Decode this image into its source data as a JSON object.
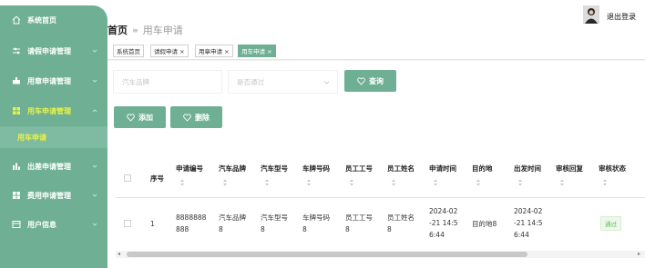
{
  "sidebar": {
    "items": [
      {
        "label": "系统首页",
        "icon": "home-icon"
      },
      {
        "label": "请假申请管理",
        "icon": "sliders-icon"
      },
      {
        "label": "用章申请管理",
        "icon": "stamp-icon"
      },
      {
        "label": "用车申请管理",
        "icon": "grid-icon"
      },
      {
        "label": "出差申请管理",
        "icon": "bar-chart-icon"
      },
      {
        "label": "费用申请管理",
        "icon": "grid-icon"
      },
      {
        "label": "用户信息",
        "icon": "card-icon"
      }
    ],
    "active_sub": "用车申请"
  },
  "header": {
    "breadcrumb_home": "首页",
    "breadcrumb_current": "用车申请",
    "logout_label": "退出登录"
  },
  "tags": [
    {
      "label": "系统首页"
    },
    {
      "label": "请假申请 ×"
    },
    {
      "label": "用章申请 ×"
    },
    {
      "label": "用车申请 ×"
    }
  ],
  "search": {
    "brand_placeholder": "汽车品牌",
    "approval_placeholder": "是否通过",
    "query_label": "查询"
  },
  "actions": {
    "add_label": "添加",
    "delete_label": "删除"
  },
  "table": {
    "columns": [
      "序号",
      "申请编号",
      "汽车品牌",
      "汽车型号",
      "车牌号码",
      "员工工号",
      "员工姓名",
      "申请时间",
      "目的地",
      "出发时间",
      "审核回复",
      "审核状态"
    ],
    "rows": [
      {
        "index": "1",
        "apply_no": "8888888\n888",
        "brand": "汽车品牌\n8",
        "model": "汽车型号\n8",
        "plate": "车牌号码\n8",
        "emp_no": "员工工号\n8",
        "emp_name": "员工姓名\n8",
        "apply_time": "2024-02\n-21 14:5\n6:44",
        "destination": "目的地8",
        "depart_time": "2024-02\n-21 14:5\n6:44",
        "reply": "",
        "status": "通过"
      }
    ]
  },
  "colors": {
    "accent": "#6fb094",
    "active_text": "#e8f34a",
    "status_green": "#5bbd5b"
  }
}
